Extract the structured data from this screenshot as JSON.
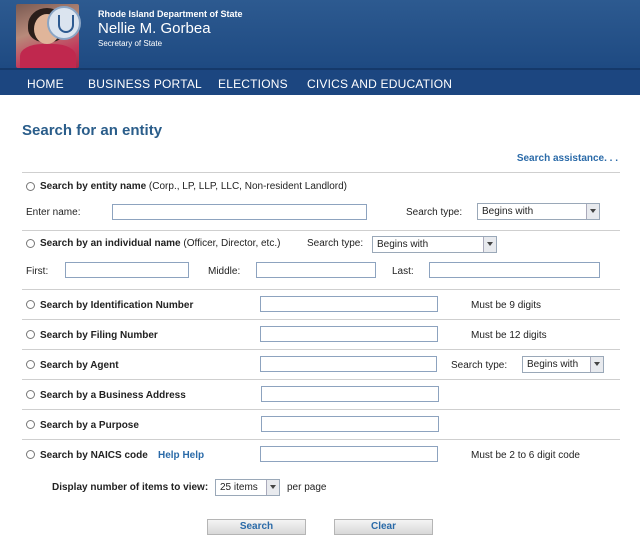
{
  "header": {
    "dept": "Rhode Island Department of State",
    "name": "Nellie M. Gorbea",
    "title": "Secretary of State"
  },
  "nav": {
    "items": [
      "HOME",
      "BUSINESS PORTAL",
      "ELECTIONS",
      "CIVICS AND EDUCATION"
    ]
  },
  "page": {
    "title": "Search for an entity",
    "assistance": "Search assistance. . ."
  },
  "entity": {
    "label_bold": "Search by entity name",
    "label_rest": " (Corp., LP, LLP, LLC, Non-resident Landlord)",
    "enter_name": "Enter name:",
    "search_type": "Search type:",
    "select": "Begins with"
  },
  "individual": {
    "label_bold": "Search by an individual name",
    "label_rest": " (Officer, Director, etc.)",
    "search_type": "Search type:",
    "select": "Begins with",
    "first": "First:",
    "middle": "Middle:",
    "last": "Last:"
  },
  "idnum": {
    "label": "Search by Identification Number",
    "hint": "Must be 9 digits"
  },
  "filing": {
    "label": "Search by Filing Number",
    "hint": "Must be 12 digits"
  },
  "agent": {
    "label": "Search by Agent",
    "search_type": "Search type:",
    "select": "Begins with"
  },
  "address": {
    "label": "Search by a Business Address"
  },
  "purpose": {
    "label": "Search by a Purpose"
  },
  "naics": {
    "label": "Search by NAICS code",
    "help": "Help Help",
    "hint": "Must be 2 to 6 digit code"
  },
  "display": {
    "label": "Display number of items to view:",
    "select": "25 items",
    "suffix": "per page"
  },
  "buttons": {
    "search": "Search",
    "clear": "Clear"
  }
}
